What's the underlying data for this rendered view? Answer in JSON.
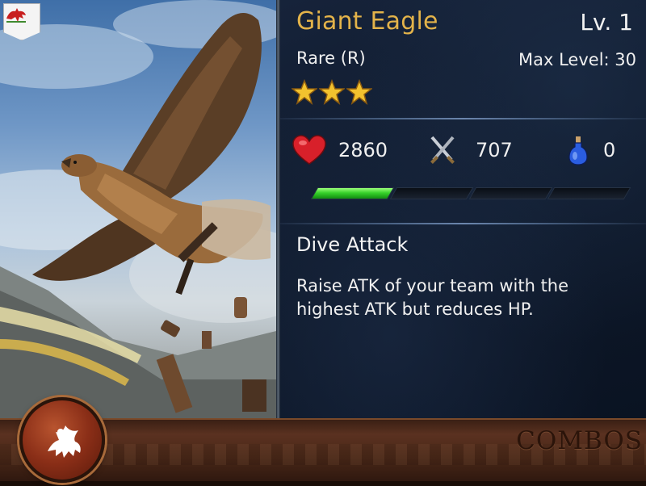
{
  "card": {
    "name": "Giant Eagle",
    "level": "Lv. 1",
    "rarity": "Rare (R)",
    "max_level": "Max Level: 30",
    "stars": 3
  },
  "stats": {
    "hp": "2860",
    "atk": "707",
    "mp": "0",
    "xp_progress": 0.25
  },
  "skill": {
    "name": "Dive Attack",
    "description": "Raise ATK of your team with the highest ATK but reduces HP."
  },
  "bottom_bar": {
    "label": "COMBOS"
  },
  "icons": {
    "flag": "dragon-flag-icon",
    "hp": "heart-icon",
    "atk": "crossed-swords-icon",
    "mp": "potion-icon",
    "emblem": "griffin-emblem-icon"
  },
  "colors": {
    "name": "#e3b34a",
    "xp_fill": "#38d22b",
    "heart": "#d8202a"
  }
}
